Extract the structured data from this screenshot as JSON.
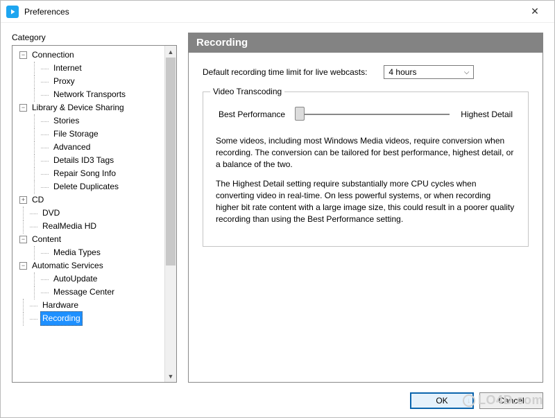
{
  "window": {
    "title": "Preferences",
    "close_glyph": "✕"
  },
  "sidebar": {
    "heading": "Category",
    "items": [
      {
        "label": "Connection",
        "level": 1,
        "expand": "minus"
      },
      {
        "label": "Internet",
        "level": 2,
        "expand": "none"
      },
      {
        "label": "Proxy",
        "level": 2,
        "expand": "none"
      },
      {
        "label": "Network Transports",
        "level": 2,
        "expand": "none"
      },
      {
        "label": "Library & Device Sharing",
        "level": 1,
        "expand": "minus"
      },
      {
        "label": "Stories",
        "level": 2,
        "expand": "none"
      },
      {
        "label": "File Storage",
        "level": 2,
        "expand": "none"
      },
      {
        "label": "Advanced",
        "level": 2,
        "expand": "none"
      },
      {
        "label": "Details ID3 Tags",
        "level": 2,
        "expand": "none"
      },
      {
        "label": "Repair Song Info",
        "level": 2,
        "expand": "none"
      },
      {
        "label": "Delete Duplicates",
        "level": 2,
        "expand": "none"
      },
      {
        "label": "CD",
        "level": 1,
        "expand": "plus"
      },
      {
        "label": "DVD",
        "level": 1,
        "expand": "leaf"
      },
      {
        "label": "RealMedia HD",
        "level": 1,
        "expand": "leaf"
      },
      {
        "label": "Content",
        "level": 1,
        "expand": "minus"
      },
      {
        "label": "Media Types",
        "level": 2,
        "expand": "none"
      },
      {
        "label": "Automatic Services",
        "level": 1,
        "expand": "minus"
      },
      {
        "label": "AutoUpdate",
        "level": 2,
        "expand": "none"
      },
      {
        "label": "Message Center",
        "level": 2,
        "expand": "none"
      },
      {
        "label": "Hardware",
        "level": 1,
        "expand": "leaf"
      },
      {
        "label": "Recording",
        "level": 1,
        "expand": "leaf",
        "selected": true
      }
    ]
  },
  "panel": {
    "title": "Recording",
    "time_limit_label": "Default recording time limit for live webcasts:",
    "time_limit_value": "4 hours",
    "group_title": "Video Transcoding",
    "slider_left": "Best Performance",
    "slider_right": "Highest Detail",
    "p1": "Some videos, including most Windows Media videos, require conversion when recording.  The conversion can be tailored for best performance, highest detail, or a balance of the two.",
    "p2": "The Highest Detail setting require substantially more CPU cycles when converting video in real-time.  On less powerful systems, or when recording higher bit rate content with a large image size, this could result in a poorer quality recording than using the Best Performance setting."
  },
  "buttons": {
    "ok": "OK",
    "cancel": "Cancel"
  },
  "watermark": "LO4D.com"
}
